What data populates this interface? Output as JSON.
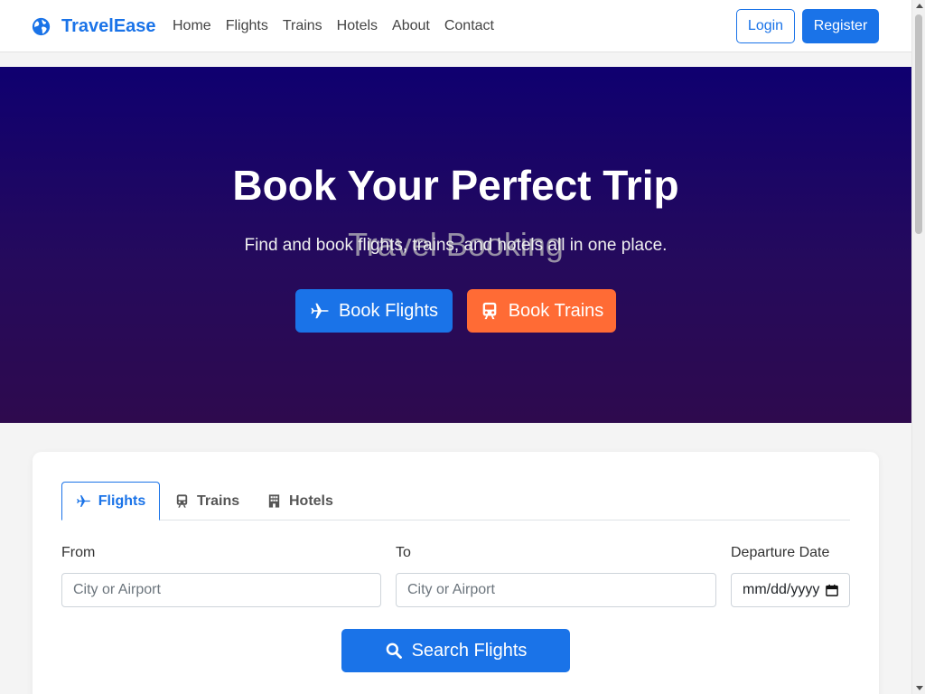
{
  "nav": {
    "brand": "TravelEase",
    "links": [
      "Home",
      "Flights",
      "Trains",
      "Hotels",
      "About",
      "Contact"
    ],
    "login_label": "Login",
    "register_label": "Register"
  },
  "hero": {
    "title": "Book Your Perfect Trip",
    "watermark": "Travel Booking",
    "subtitle": "Find and book flights, trains, and hotels all in one place.",
    "flights_button": "Book Flights",
    "trains_button": "Book Trains"
  },
  "search": {
    "tabs": [
      "Flights",
      "Trains",
      "Hotels"
    ],
    "active_tab": "Flights",
    "from_label": "From",
    "from_placeholder": "City or Airport",
    "to_label": "To",
    "to_placeholder": "City or Airport",
    "date_label": "Departure Date",
    "date_placeholder": "mm/dd/yyyy",
    "search_button": "Search Flights"
  },
  "colors": {
    "primary": "#1a73e8",
    "accent": "#ff6b35",
    "hero_top": "#0f0070",
    "hero_bottom": "#2e0a4e"
  },
  "icons": {
    "brand": "globe-icon",
    "flights": "plane-icon",
    "trains": "train-icon",
    "hotels": "building-icon",
    "search": "search-icon",
    "date": "calendar-icon"
  }
}
